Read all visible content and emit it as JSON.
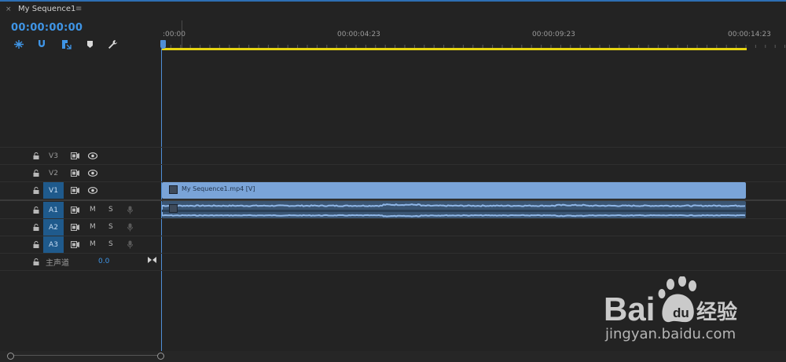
{
  "panel": {
    "close_glyph": "×",
    "title": "My Sequence1",
    "menu_glyph": "≡"
  },
  "timecode": "00:00:00:00",
  "toolbar": {
    "tools": [
      {
        "icon": "nest-sequence-icon"
      },
      {
        "icon": "snap-magnet-icon"
      },
      {
        "icon": "linked-selection-icon"
      },
      {
        "icon": "add-marker-icon"
      },
      {
        "icon": "wrench-settings-icon"
      }
    ]
  },
  "ruler": {
    "labels": [
      ":00:00",
      "00:00:04:23",
      "00:00:09:23",
      "00:00:14:23"
    ]
  },
  "tracks": {
    "video": [
      {
        "name": "V3",
        "active": false
      },
      {
        "name": "V2",
        "active": false
      },
      {
        "name": "V1",
        "active": true
      }
    ],
    "audio": [
      {
        "name": "A1",
        "active": true,
        "mute": "M",
        "solo": "S"
      },
      {
        "name": "A2",
        "active": true,
        "mute": "M",
        "solo": "S"
      },
      {
        "name": "A3",
        "active": true,
        "mute": "M",
        "solo": "S"
      }
    ],
    "master": {
      "name": "主声道",
      "value": "0.0"
    }
  },
  "clips": {
    "video_label": "My Sequence1.mp4 [V]",
    "fx_glyph": "fx"
  },
  "watermark": {
    "url": "jingyan.baidu.com"
  },
  "colors": {
    "accent": "#3f95e6",
    "video_clip": "#7aa4d8",
    "audio_clip": "#3a5573",
    "work_area": "#e6d412",
    "track_active": "#1f5a8c"
  }
}
